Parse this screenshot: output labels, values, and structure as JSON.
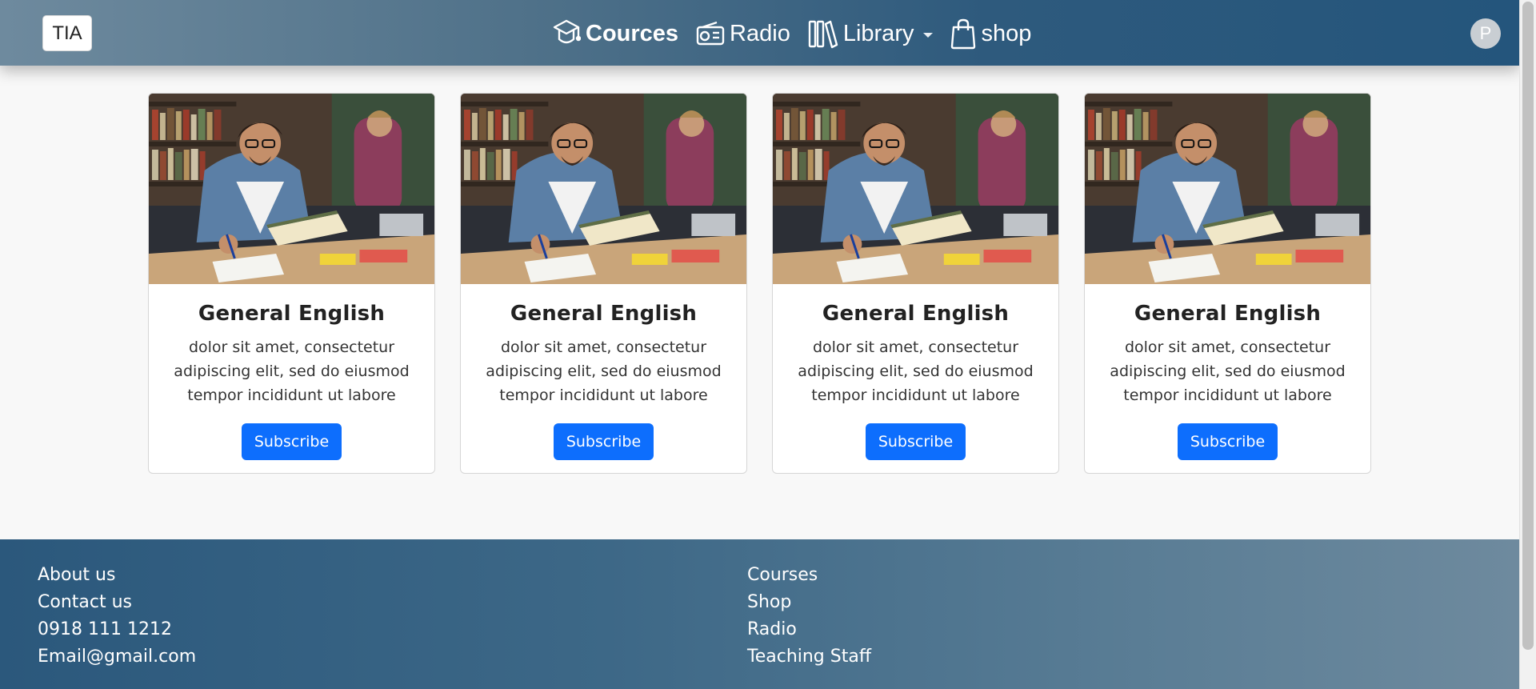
{
  "navbar": {
    "brand": "TIA",
    "items": [
      {
        "label": "Cources",
        "icon": "graduation-cap-icon",
        "active": true
      },
      {
        "label": "Radio",
        "icon": "radio-icon",
        "active": false
      },
      {
        "label": "Library",
        "icon": "books-icon",
        "active": false,
        "dropdown": true
      },
      {
        "label": "shop",
        "icon": "shopping-bag-icon",
        "active": false
      }
    ],
    "avatar_initial": "P"
  },
  "cards": [
    {
      "title": "General English",
      "text": "dolor sit amet, consectetur adipiscing elit, sed do eiusmod tempor incididunt ut labore",
      "button": "Subscribe",
      "image": "student-studying-in-library-photo"
    },
    {
      "title": "General English",
      "text": "dolor sit amet, consectetur adipiscing elit, sed do eiusmod tempor incididunt ut labore",
      "button": "Subscribe",
      "image": "student-studying-in-library-photo"
    },
    {
      "title": "General English",
      "text": "dolor sit amet, consectetur adipiscing elit, sed do eiusmod tempor incididunt ut labore",
      "button": "Subscribe",
      "image": "student-studying-in-library-photo"
    },
    {
      "title": "General English",
      "text": "dolor sit amet, consectetur adipiscing elit, sed do eiusmod tempor incididunt ut labore",
      "button": "Subscribe",
      "image": "student-studying-in-library-photo"
    }
  ],
  "footer": {
    "col1": [
      "About us",
      "Contact us",
      "0918 111 1212",
      "Email@gmail.com"
    ],
    "col2": [
      "Courses",
      "Shop",
      "Radio",
      "Teaching Staff"
    ]
  },
  "colors": {
    "primary_button": "#0d6efd",
    "navbar_dark": "#24557c",
    "navbar_light": "#6e8a9e"
  }
}
